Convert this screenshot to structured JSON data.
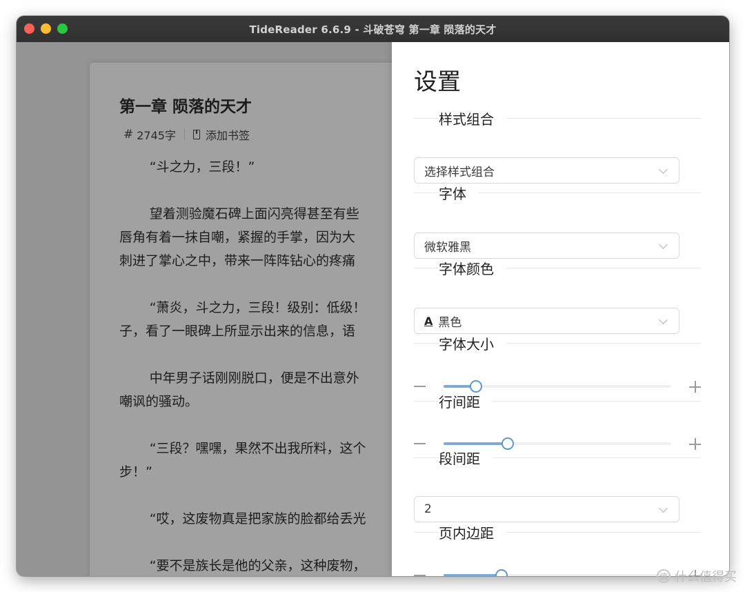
{
  "window": {
    "title": "TideReader 6.6.9 - 斗破苍穹 第一章 陨落的天才"
  },
  "reader": {
    "chapter_title": "第一章 陨落的天才",
    "word_count_icon": "#",
    "word_count": "2745字",
    "bookmark_label": "添加书签",
    "paragraphs": [
      [
        "“斗之力，三段！”"
      ],
      [
        "望着测验魔石碑上面闪亮得甚至有些",
        "唇角有着一抹自嘲，紧握的手掌，因为大",
        "刺进了掌心之中，带来一阵阵钻心的疼痛"
      ],
      [
        "“萧炎，斗之力，三段！级别：低级！",
        "子，看了一眼碑上所显示出来的信息，语"
      ],
      [
        "中年男子话刚刚脱口，便是不出意外",
        "嘲讽的骚动。"
      ],
      [
        "“三段？嘿嘿，果然不出我所料，这个",
        "步！”"
      ],
      [
        "“哎，这废物真是把家族的脸都给丢光"
      ],
      [
        "“要不是族长是他的父亲，这种废物，"
      ]
    ]
  },
  "settings": {
    "title": "设置",
    "style_combo": {
      "label": "样式组合",
      "value": "选择样式组合"
    },
    "font": {
      "label": "字体",
      "value": "微软雅黑"
    },
    "font_color": {
      "label": "字体颜色",
      "icon": "A",
      "value": "黑色"
    },
    "font_size": {
      "label": "字体大小",
      "level": 0.14
    },
    "line_spacing": {
      "label": "行间距",
      "level": 0.28
    },
    "paragraph_spacing": {
      "label": "段间距",
      "value": "2"
    },
    "page_padding": {
      "label": "页内边距",
      "level": 0.25
    }
  },
  "watermark": {
    "icon": "值",
    "text": "什么值得买"
  }
}
